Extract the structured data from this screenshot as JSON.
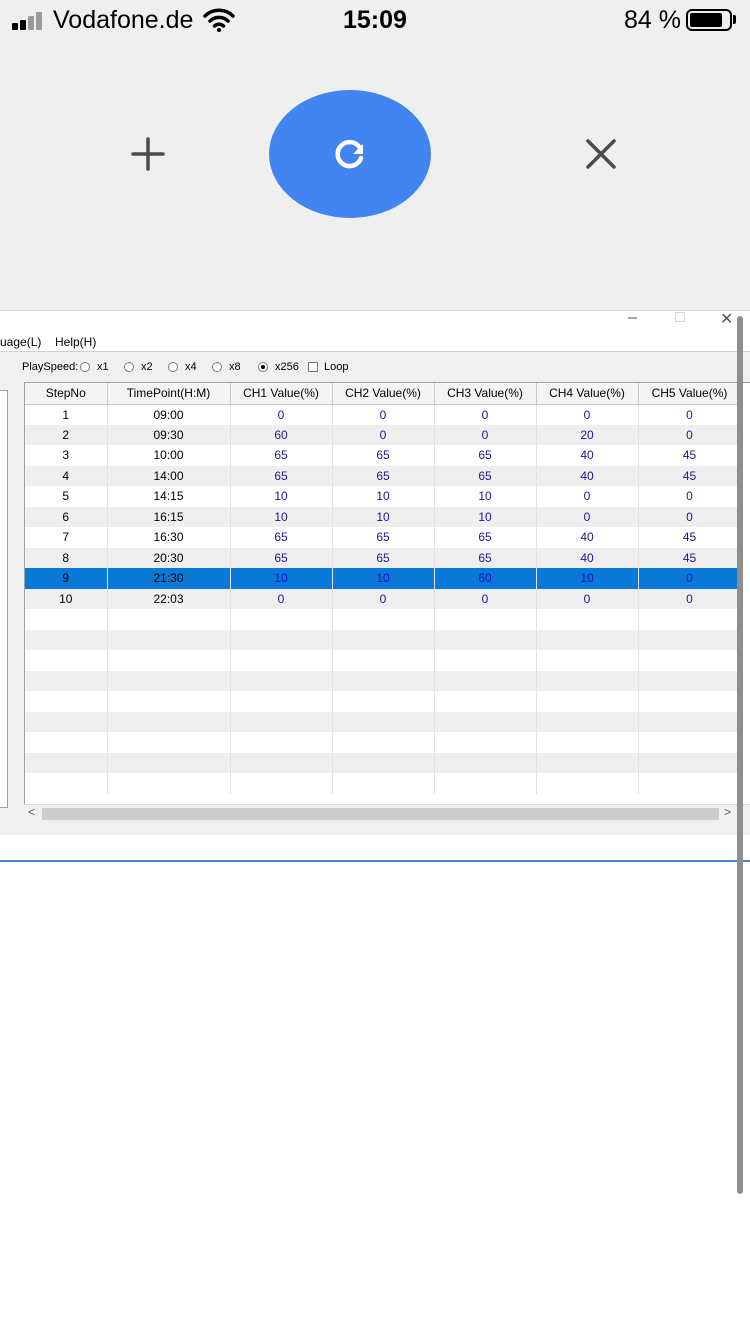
{
  "status_bar": {
    "carrier": "Vodafone.de",
    "time": "15:09",
    "battery_percent": "84 %",
    "battery_level": 0.84
  },
  "toolbar": {
    "add_icon": "plus-icon",
    "refresh_icon": "refresh-icon",
    "close_icon": "close-icon",
    "accent_color": "#4285f0"
  },
  "window": {
    "controls": {
      "minimize": "–",
      "maximize": "□",
      "close": "✕"
    },
    "menu": {
      "language": "uage(L)",
      "help": "Help(H)"
    },
    "playspeed": {
      "label": "PlaySpeed:",
      "options": [
        "x1",
        "x2",
        "x4",
        "x8",
        "x256"
      ],
      "selected": "x256",
      "loop_label": "Loop",
      "loop_checked": false
    },
    "table": {
      "columns": [
        "StepNo",
        "TimePoint(H:M)",
        "CH1 Value(%)",
        "CH2 Value(%)",
        "CH3 Value(%)",
        "CH4 Value(%)",
        "CH5 Value(%)"
      ],
      "rows": [
        [
          "1",
          "09:00",
          "0",
          "0",
          "0",
          "0",
          "0"
        ],
        [
          "2",
          "09:30",
          "60",
          "0",
          "0",
          "20",
          "0"
        ],
        [
          "3",
          "10:00",
          "65",
          "65",
          "65",
          "40",
          "45"
        ],
        [
          "4",
          "14:00",
          "65",
          "65",
          "65",
          "40",
          "45"
        ],
        [
          "5",
          "14:15",
          "10",
          "10",
          "10",
          "0",
          "0"
        ],
        [
          "6",
          "16:15",
          "10",
          "10",
          "10",
          "0",
          "0"
        ],
        [
          "7",
          "16:30",
          "65",
          "65",
          "65",
          "40",
          "45"
        ],
        [
          "8",
          "20:30",
          "65",
          "65",
          "65",
          "40",
          "45"
        ],
        [
          "9",
          "21:30",
          "10",
          "10",
          "60",
          "10",
          "0"
        ],
        [
          "10",
          "22:03",
          "0",
          "0",
          "0",
          "0",
          "0"
        ]
      ],
      "selected_row": 8,
      "selection_color": "#0a78d6"
    },
    "scroll": {
      "left": "<",
      "right": ">"
    }
  }
}
